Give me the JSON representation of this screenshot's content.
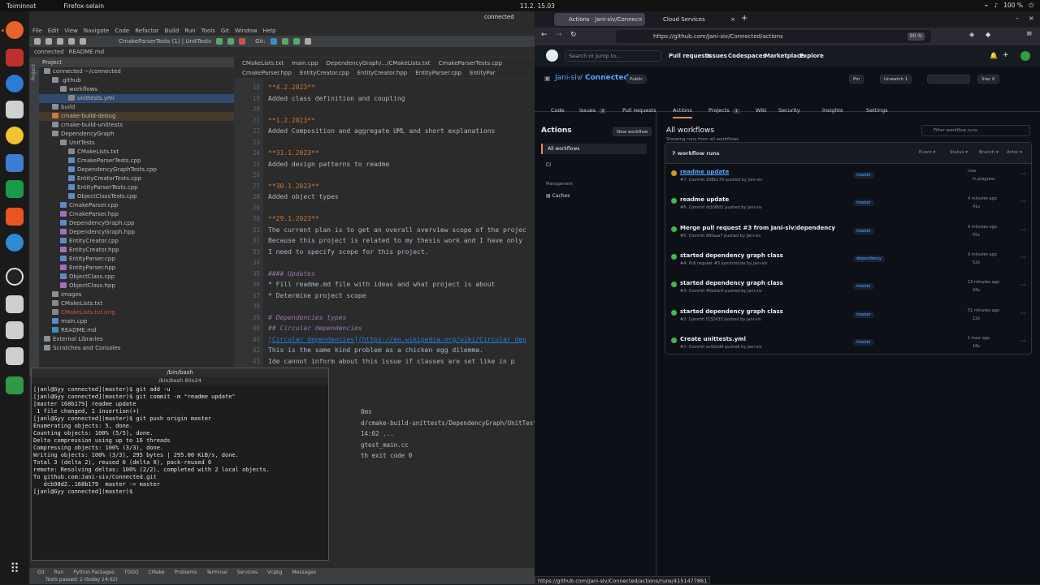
{
  "topbar": {
    "activities": "Toiminnot",
    "app": "Firefox-selain",
    "clock": "11.2. 15.03",
    "tray": "100 %"
  },
  "ide": {
    "menu": [
      "File",
      "Edit",
      "View",
      "Navigate",
      "Code",
      "Refactor",
      "Build",
      "Run",
      "Tools",
      "Git",
      "Window",
      "Help"
    ],
    "run_config": "CmakeParserTests (1) | UnitTests",
    "git_label": "Git:",
    "breadcrumb": [
      "connected",
      "README.md"
    ],
    "project_label": "Project",
    "tree": [
      {
        "label": "connected ~/connected",
        "indent": 0,
        "icon": "folder"
      },
      {
        "label": ".github",
        "indent": 1,
        "icon": "folder"
      },
      {
        "label": "workflows",
        "indent": 2,
        "icon": "folder"
      },
      {
        "label": "unittests.yml",
        "indent": 3,
        "icon": "file-t",
        "sel": true
      },
      {
        "label": "build",
        "indent": 1,
        "icon": "folder"
      },
      {
        "label": "cmake-build-debug",
        "indent": 1,
        "icon": "gen",
        "hl": true
      },
      {
        "label": "cmake-build-unittests",
        "indent": 1,
        "icon": "folder"
      },
      {
        "label": "DependencyGraph",
        "indent": 1,
        "icon": "folder"
      },
      {
        "label": "UnitTests",
        "indent": 2,
        "icon": "folder"
      },
      {
        "label": "CMakeLists.txt",
        "indent": 3,
        "icon": "file-t"
      },
      {
        "label": "CmakeParserTests.cpp",
        "indent": 3,
        "icon": "file-c"
      },
      {
        "label": "DependencyGraphTests.cpp",
        "indent": 3,
        "icon": "file-c"
      },
      {
        "label": "EntityCreatorTests.cpp",
        "indent": 3,
        "icon": "file-c"
      },
      {
        "label": "EntityParserTests.cpp",
        "indent": 3,
        "icon": "file-c"
      },
      {
        "label": "ObjectClassTests.cpp",
        "indent": 3,
        "icon": "file-c"
      },
      {
        "label": "CmakeParser.cpp",
        "indent": 2,
        "icon": "file-c"
      },
      {
        "label": "CmakeParser.hpp",
        "indent": 2,
        "icon": "file-h"
      },
      {
        "label": "DependencyGraph.cpp",
        "indent": 2,
        "icon": "file-c"
      },
      {
        "label": "DependencyGraph.hpp",
        "indent": 2,
        "icon": "file-h"
      },
      {
        "label": "EntityCreator.cpp",
        "indent": 2,
        "icon": "file-c"
      },
      {
        "label": "EntityCreator.hpp",
        "indent": 2,
        "icon": "file-h"
      },
      {
        "label": "EntityParser.cpp",
        "indent": 2,
        "icon": "file-c"
      },
      {
        "label": "EntityParser.hpp",
        "indent": 2,
        "icon": "file-h"
      },
      {
        "label": "ObjectClass.cpp",
        "indent": 2,
        "icon": "file-c"
      },
      {
        "label": "ObjectClass.hpp",
        "indent": 2,
        "icon": "file-h"
      },
      {
        "label": "images",
        "indent": 1,
        "icon": "folder"
      },
      {
        "label": "CMakeLists.txt",
        "indent": 1,
        "icon": "file-t"
      },
      {
        "label": "CMakeLists.txt.orig",
        "indent": 1,
        "icon": "file-t",
        "red": true
      },
      {
        "label": "main.cpp",
        "indent": 1,
        "icon": "file-c"
      },
      {
        "label": "README.md",
        "indent": 1,
        "icon": "file-m"
      },
      {
        "label": "External Libraries",
        "indent": 0,
        "icon": "folder"
      },
      {
        "label": "Scratches and Consoles",
        "indent": 0,
        "icon": "folder"
      }
    ],
    "tabs_row1": [
      "CMakeLists.txt",
      "main.cpp",
      "DependencyGraph/.../CMakeLists.txt",
      "CmakeParserTests.cpp"
    ],
    "tabs_row2": [
      "CmakeParser.hpp",
      "EntityCreator.cpp",
      "EntityCreator.hpp",
      "EntityParser.cpp",
      "EntityPar"
    ],
    "code": [
      {
        "n": "18",
        "t": "**4.2.2023**",
        "cls": "hdr"
      },
      {
        "n": "19",
        "t": "Added class definition and coupling",
        "cls": ""
      },
      {
        "n": "20",
        "t": "",
        "cls": ""
      },
      {
        "n": "21",
        "t": "**1.2.2023**",
        "cls": "hdr"
      },
      {
        "n": "22",
        "t": "Added Composition and aggregate UML and short explanations",
        "cls": ""
      },
      {
        "n": "23",
        "t": "",
        "cls": ""
      },
      {
        "n": "24",
        "t": "**31.1.2023**",
        "cls": "hdr"
      },
      {
        "n": "25",
        "t": "Added design patterns to readme",
        "cls": ""
      },
      {
        "n": "26",
        "t": "",
        "cls": ""
      },
      {
        "n": "27",
        "t": "**30.1.2023**",
        "cls": "hdr"
      },
      {
        "n": "28",
        "t": "Added object types",
        "cls": ""
      },
      {
        "n": "29",
        "t": "",
        "cls": ""
      },
      {
        "n": "30",
        "t": "**29.1.2023**",
        "cls": "hdr"
      },
      {
        "n": "31",
        "t": "The current plan is to get an overall overview scope of the projec",
        "cls": ""
      },
      {
        "n": "32",
        "t": "Because this project is related to my thesis work and I have only",
        "cls": ""
      },
      {
        "n": "33",
        "t": "I need to specify scope for this project.",
        "cls": ""
      },
      {
        "n": "34",
        "t": "",
        "cls": ""
      },
      {
        "n": "35",
        "t": "#### Updates",
        "cls": "it"
      },
      {
        "n": "36",
        "t": "* Fill readme.md file with ideas and what project is about",
        "cls": ""
      },
      {
        "n": "37",
        "t": "* Determine project scope",
        "cls": ""
      },
      {
        "n": "38",
        "t": "",
        "cls": ""
      },
      {
        "n": "39",
        "t": "# Dependencies types",
        "cls": "it"
      },
      {
        "n": "40",
        "t": "## Circular dependencies",
        "cls": "it"
      },
      {
        "n": "41",
        "t": "[Circular dependencies](https://en.wikipedia.org/wiki/Circular_dep",
        "cls": "lnk"
      },
      {
        "n": "42",
        "t": "This is the same kind problem as a chicken egg dilemma.",
        "cls": ""
      },
      {
        "n": "43",
        "t": "Ide cannot inform about this issue if classes are set like in p",
        "cls": ""
      }
    ],
    "terminal_title": "/bin/bash",
    "terminal_size": "/bin/bash 80x24",
    "terminal": [
      "[janl@Gyy connected](master)$ git add -u",
      "[janl@Gyy connected](master)$ git commit -m \"readme update\"",
      "[master 168b179] readme update",
      " 1 file changed, 1 insertion(+)",
      "[janl@Gyy connected](master)$ git push origin master",
      "Enumerating objects: 5, done.",
      "Counting objects: 100% (5/5), done.",
      "Delta compression using up to 16 threads",
      "Compressing objects: 100% (3/3), done.",
      "Writing objects: 100% (3/3), 295 bytes | 295.00 KiB/s, done.",
      "Total 3 (delta 2), reused 0 (delta 0), pack-reused 0",
      "remote: Resolving deltas: 100% (2/2), completed with 2 local objects.",
      "To github.com:Jani-siv/Connected.git",
      "   dcb98d2..168b179  master -> master",
      "[janl@Gyy connected](master)$ "
    ],
    "run_lines": [
      "0ms",
      "d/cmake-build-unittests/DependencyGraph/UnitTests/",
      "14:02 ...",
      "  gtest_main.cc",
      "th exit code 0"
    ],
    "bottom_tabs": [
      "Git",
      "Run",
      "Python Packages",
      "TODO",
      "CMake",
      "Problems",
      "Terminal",
      "Services",
      "Vcpkg",
      "Messages"
    ],
    "status": "Tests passed: 2 (today 14:02)"
  },
  "firefox": {
    "tabs": [
      "Actions · Jani-siv/Connec",
      "Cloud Services"
    ],
    "url": "https://github.com/Jani-siv/Connected/actions",
    "zoom": "90 %",
    "status_url": "https://github.com/Jani-siv/Connected/actions/runs/4151477861"
  },
  "github": {
    "search": "Search or jump to...",
    "nav": [
      "Pull requests",
      "Issues",
      "Codespaces",
      "Marketplace",
      "Explore"
    ],
    "owner": "Jani-siv",
    "sep": "/",
    "repo": "Connected",
    "visibility": "Public",
    "pin": "Pin",
    "unwatch": "Unwatch",
    "unwatch_count": "1",
    "star": "Star",
    "star_count": "0",
    "tabs": [
      {
        "label": "Code",
        "count": ""
      },
      {
        "label": "Issues",
        "count": "2"
      },
      {
        "label": "Pull requests",
        "count": ""
      },
      {
        "label": "Actions",
        "count": ""
      },
      {
        "label": "Projects",
        "count": "1"
      },
      {
        "label": "Wiki",
        "count": ""
      },
      {
        "label": "Security",
        "count": ""
      },
      {
        "label": "Insights",
        "count": ""
      },
      {
        "label": "Settings",
        "count": ""
      }
    ],
    "side_title": "Actions",
    "new_workflow": "New workflow",
    "all_workflows": "All workflows",
    "ci": "CI",
    "management": "Management",
    "caches": "Caches",
    "main_title": "All workflows",
    "main_sub": "Showing runs from all workflows",
    "filter": "Filter workflow runs",
    "run_count": "7 workflow runs",
    "filters": [
      "Event",
      "Status",
      "Branch",
      "Actor"
    ],
    "runs": [
      {
        "title": "readme update",
        "sub": "#7: Commit 168b179 pushed by Jani-siv",
        "branch": "master",
        "t1": "now",
        "t2": "In progress",
        "progress": true
      },
      {
        "title": "readme update",
        "sub": "#6: Commit dcb98d2 pushed by Jani-siv",
        "branch": "master",
        "t1": "4 minutes ago",
        "t2": "41s",
        "progress": false
      },
      {
        "title": "Merge pull request #3 from Jani-siv/dependency",
        "sub": "#5: Commit 68faaa7 pushed by Jani-siv",
        "branch": "master",
        "t1": "9 minutes ago",
        "t2": "55s",
        "progress": false
      },
      {
        "title": "started dependency graph class",
        "sub": "#4: Pull request #3 synchronize by Jani-siv",
        "branch": "dependency",
        "t1": "9 minutes ago",
        "t2": "52s",
        "progress": false
      },
      {
        "title": "started dependency graph class",
        "sub": "#3: Commit 45bddc6 pushed by Jani-siv",
        "branch": "master",
        "t1": "13 minutes ago",
        "t2": "43s",
        "progress": false
      },
      {
        "title": "started dependency graph class",
        "sub": "#2: Commit f232433 pushed by Jani-siv",
        "branch": "master",
        "t1": "51 minutes ago",
        "t2": "12s",
        "progress": false
      },
      {
        "title": "Create unittests.yml",
        "sub": "#1: Commit ac92ed4 pushed by Jani-siv",
        "branch": "master",
        "t1": "1 hour ago",
        "t2": "18s",
        "progress": false
      }
    ]
  }
}
